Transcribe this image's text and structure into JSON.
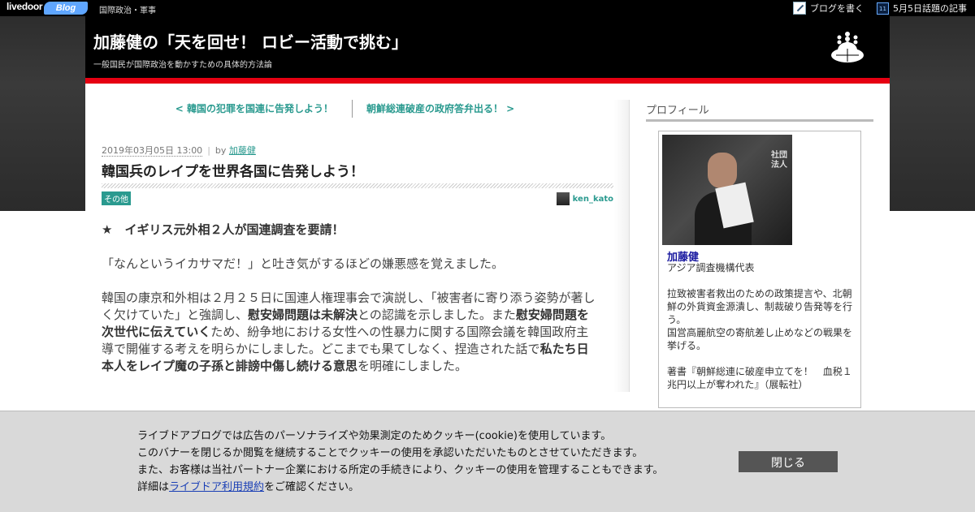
{
  "topbar": {
    "logo_text": "livedoor",
    "logo_blog": "Blog",
    "category": "国際政治・軍事",
    "write_blog": "ブログを書く",
    "trending": "5月5日話題の記事"
  },
  "header": {
    "title": "加藤健の「天を回せ！ ロビー活動で挑む」",
    "description": "一般国民が国際政治を動かすための具体的方法論"
  },
  "pager": {
    "prev": "< 韓国の犯罪を国連に告発しよう！",
    "next": "朝鮮総連破産の政府答弁出る！ >"
  },
  "post": {
    "date": "2019年03月05日 13:00",
    "by": "by",
    "author": "加藤健",
    "title": "韓国兵のレイプを世界各国に告発しよう！",
    "category": "その他",
    "author_id": "ken_kato",
    "heading": "★　イギリス元外相２人が国連調査を要請！",
    "para1": "「なんというイカサマだ！」と吐き気がするほどの嫌悪感を覚えました。",
    "para2_a": "韓国の康京和外相は２月２５日に国連人権理事会で演説し、「被害者に寄り添う姿勢が著しく欠けていた」と強調し、",
    "para2_b": "慰安婦問題は未解決",
    "para2_c": "との認識を示しました。また",
    "para2_d": "慰安婦問題を次世代に伝えていく",
    "para2_e": "ため、紛争地における女性への性暴力に関する国際会議を韓国政府主導で開催する考えを明らかにしました。どこまでも果てしなく、捏造された話で",
    "para2_f": "私たち日本人をレイプ魔の子孫と誹謗中傷し続ける意思",
    "para2_g": "を明確にしました。"
  },
  "sidebar": {
    "heading": "プロフィール",
    "name": "加藤健",
    "role": "アジア調査機構代表",
    "bio1": "拉致被害者救出のための政策提言や、北朝鮮の外貨資金源潰し、制裁破り告発等を行う。",
    "bio2": "国営高麗航空の寄航差し止めなどの戦果を挙げる。",
    "bio3": "著書『朝鮮総連に破産申立てを！　血税１兆円以上が奪われた』（展転社）",
    "photo_sign": "社団\n法人"
  },
  "cookie": {
    "line1": "ライブドアブログでは広告のパーソナライズや効果測定のためクッキー(cookie)を使用しています。",
    "line2": "このバナーを閉じるか閲覧を継続することでクッキーの使用を承認いただいたものとさせていただきます。",
    "line3": "また、お客様は当社パートナー企業における所定の手続きにより、クッキーの使用を管理することもできます。",
    "line4_prefix": "詳細は",
    "line4_link": "ライブドア利用規約",
    "line4_suffix": "をご確認ください。",
    "close_label": "閉じる"
  },
  "colors": {
    "accent": "#2a9a8f",
    "header_bg": "#000000",
    "red_bar": "#e60012",
    "button_bg": "#555555"
  }
}
